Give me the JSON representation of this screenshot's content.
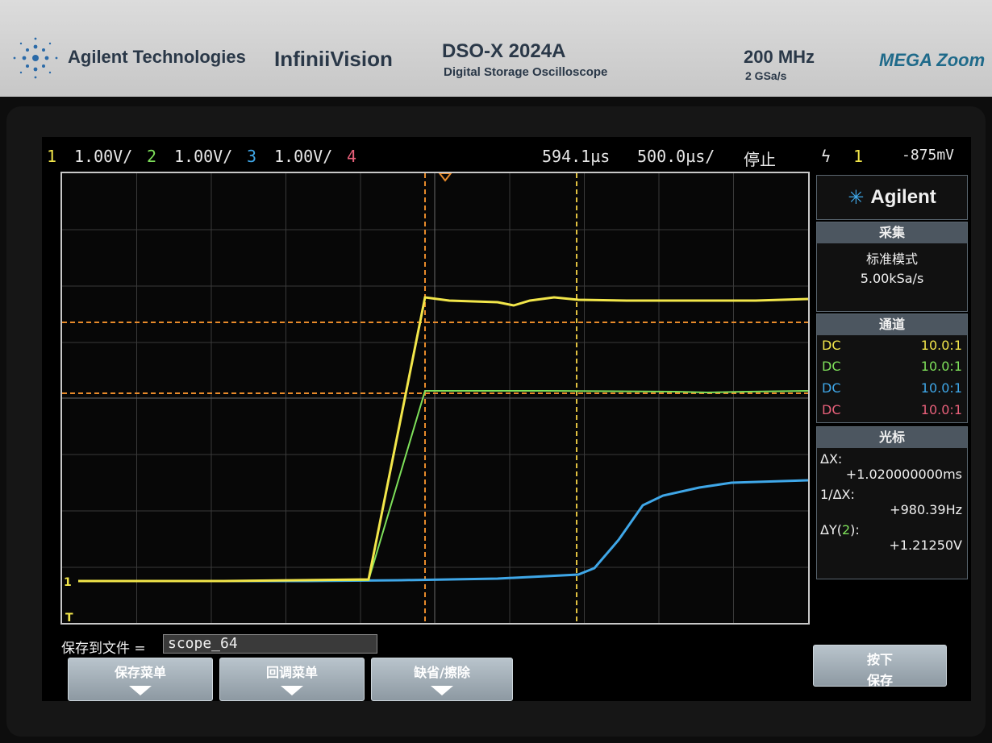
{
  "bezel": {
    "brand": "Agilent Technologies",
    "product": "InfiniiVision",
    "model": "DSO-X 2024A",
    "model_desc": "Digital Storage Oscilloscope",
    "bandwidth": "200 MHz",
    "sample_rate": "2 GSa/s",
    "zoom_logo": "MEGA Zoom"
  },
  "status_bar": {
    "ch1_num": "1",
    "ch1_scale": "1.00V/",
    "ch2_num": "2",
    "ch2_scale": "1.00V/",
    "ch3_num": "3",
    "ch3_scale": "1.00V/",
    "ch4_num": "4",
    "time_delay": "594.1µs",
    "time_scale": "500.0µs/",
    "run_state": "停止",
    "trigger_icon": "lightning-icon",
    "trigger_src": "1",
    "trigger_level": "-875mV"
  },
  "colors": {
    "ch1": "#f2e64a",
    "ch2": "#7ee05a",
    "ch3": "#3fa7e8",
    "ch4": "#e8607a",
    "cursor": "#e88a2a",
    "cursor_v": "#e0c040"
  },
  "panel": {
    "logo": "Agilent",
    "acq": {
      "title": "采集",
      "mode": "标准模式",
      "rate": "5.00kSa/s"
    },
    "channels": {
      "title": "通道",
      "rows": [
        {
          "coupling": "DC",
          "probe": "10.0:1"
        },
        {
          "coupling": "DC",
          "probe": "10.0:1"
        },
        {
          "coupling": "DC",
          "probe": "10.0:1"
        },
        {
          "coupling": "DC",
          "probe": "10.0:1"
        }
      ]
    },
    "cursors": {
      "title": "光标",
      "dx_label": "ΔX:",
      "dx_value": "+1.020000000ms",
      "inv_dx_label": "1/ΔX:",
      "inv_dx_value": "+980.39Hz",
      "dy_label": "ΔY(",
      "dy_ch": "2",
      "dy_close": "):",
      "dy_value": "+1.21250V"
    }
  },
  "save": {
    "label": "保存到文件 =",
    "filename": "scope_64"
  },
  "softkeys": {
    "k1": "保存菜单",
    "k2": "回调菜单",
    "k3": "缺省/擦除",
    "k4_line1": "按下",
    "k4_line2": "保存"
  },
  "markers": {
    "ch1_ground": "1",
    "trigger_level": "T"
  }
}
